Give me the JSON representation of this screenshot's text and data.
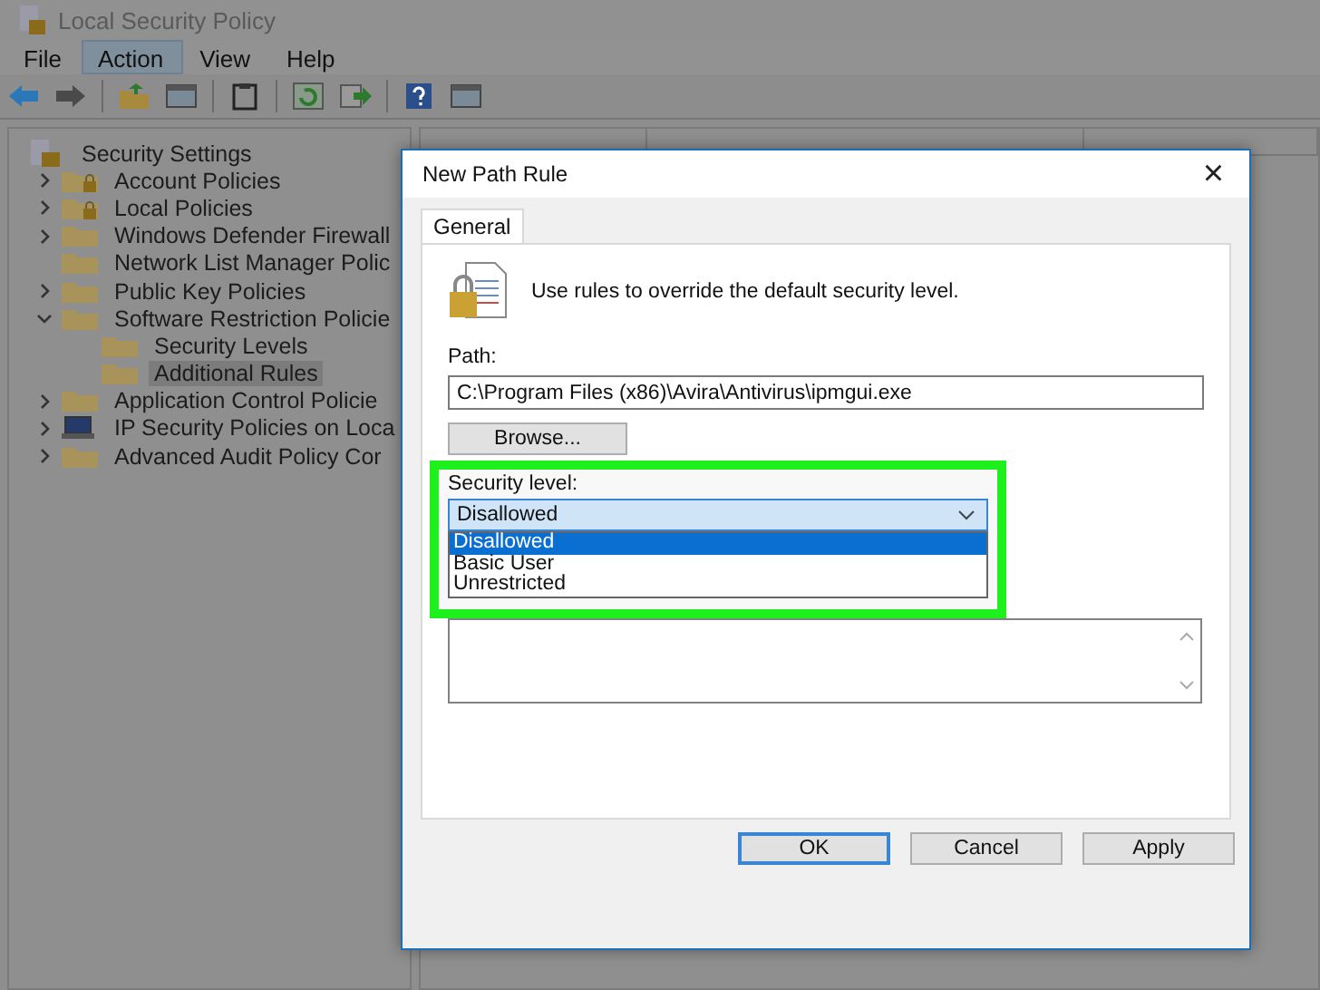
{
  "window": {
    "title": "Local Security Policy"
  },
  "menu": [
    {
      "label": "File",
      "selected": false
    },
    {
      "label": "Action",
      "selected": true
    },
    {
      "label": "View",
      "selected": false
    },
    {
      "label": "Help",
      "selected": false
    }
  ],
  "toolbar": [
    {
      "kind": "back"
    },
    {
      "kind": "forward"
    },
    {
      "kind": "sep"
    },
    {
      "kind": "folder-up"
    },
    {
      "kind": "pane"
    },
    {
      "kind": "sep"
    },
    {
      "kind": "clipboard"
    },
    {
      "kind": "sep"
    },
    {
      "kind": "refresh"
    },
    {
      "kind": "export"
    },
    {
      "kind": "sep"
    },
    {
      "kind": "help"
    },
    {
      "kind": "pane"
    }
  ],
  "tree": {
    "root": "Security Settings",
    "items": [
      {
        "label": "Account Policies",
        "kind": "lockfolder",
        "expanded": false,
        "selected": false
      },
      {
        "label": "Local Policies",
        "kind": "lockfolder",
        "expanded": false,
        "selected": false
      },
      {
        "label": "Windows Defender Firewall",
        "kind": "folder",
        "expanded": false,
        "selected": false
      },
      {
        "label": "Network List Manager Polic",
        "kind": "folder",
        "selected": false
      },
      {
        "label": "Public Key Policies",
        "kind": "folder",
        "expanded": false,
        "selected": false
      },
      {
        "label": "Software Restriction Policie",
        "kind": "folder",
        "expanded": true,
        "selected": false,
        "children": [
          {
            "label": "Security Levels",
            "kind": "folder",
            "selected": false
          },
          {
            "label": "Additional Rules",
            "kind": "folder",
            "selected": true
          }
        ]
      },
      {
        "label": "Application Control Policie",
        "kind": "folder",
        "expanded": false,
        "selected": false
      },
      {
        "label": "IP Security Policies on Loca",
        "kind": "computer",
        "expanded": false,
        "selected": false
      },
      {
        "label": "Advanced Audit Policy Cor",
        "kind": "folder",
        "expanded": false,
        "selected": false
      }
    ]
  },
  "dialog": {
    "title": "New Path Rule",
    "close": "×",
    "tabs": [
      {
        "label": "General",
        "selected": true
      }
    ],
    "intro": "Use rules to override the default security level.",
    "path": {
      "label": "Path:",
      "value": "C:\\Program Files (x86)\\Avira\\Antivirus\\ipmgui.exe"
    },
    "browse": "Browse...",
    "security_level": {
      "label": "Security level:",
      "value": "Disallowed",
      "expanded": true,
      "options": [
        {
          "label": "Disallowed",
          "selected": true
        },
        {
          "label": "Basic User",
          "selected": false
        },
        {
          "label": "Unrestricted",
          "selected": false
        }
      ]
    },
    "buttons": [
      {
        "label": "OK",
        "default": true
      },
      {
        "label": "Cancel",
        "default": false
      },
      {
        "label": "Apply",
        "default": false
      }
    ]
  }
}
